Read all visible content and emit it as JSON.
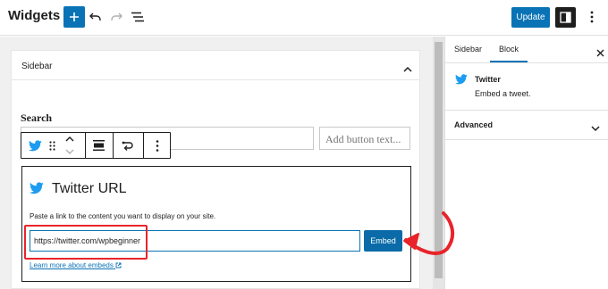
{
  "header": {
    "title": "Widgets",
    "update_label": "Update",
    "icons": [
      "plus-icon",
      "undo-icon",
      "redo-icon",
      "list-view-icon",
      "settings-sidebar-icon",
      "more-options-icon"
    ]
  },
  "canvas": {
    "panel_title": "Sidebar",
    "search_label": "Search",
    "add_button_placeholder": "Add button text...",
    "toolbar_icons": [
      "twitter-icon",
      "drag-handle-icon",
      "move-up-icon",
      "move-down-icon",
      "align-icon",
      "replace-icon",
      "more-options-icon"
    ]
  },
  "embed": {
    "title": "Twitter URL",
    "instructions": "Paste a link to the content you want to display on your site.",
    "url_value": "https://twitter.com/wpbeginner",
    "embed_label": "Embed",
    "learn_more": "Learn more about embeds",
    "annotation_color": "#e8242a"
  },
  "settings_sidebar": {
    "tabs": [
      {
        "label": "Sidebar",
        "active": false
      },
      {
        "label": "Block",
        "active": true
      }
    ],
    "block_name": "Twitter",
    "block_description": "Embed a tweet.",
    "advanced_label": "Advanced"
  },
  "colors": {
    "accent": "#0a73b6",
    "twitter_blue": "#1d9bf0",
    "annotation": "#e8242a"
  }
}
